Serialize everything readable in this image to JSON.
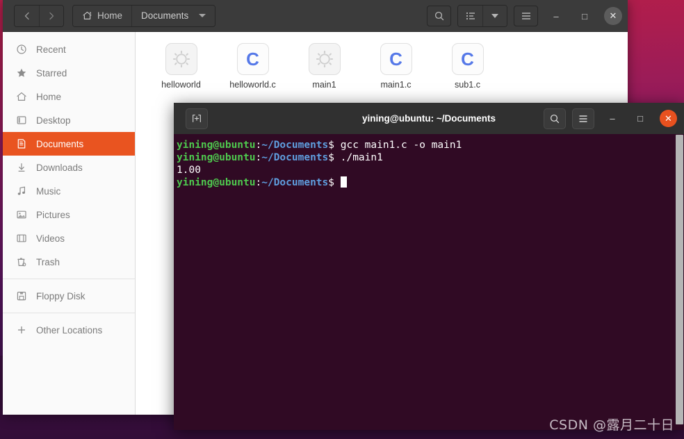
{
  "file_manager": {
    "nav": {
      "back_label": "‹",
      "forward_label": "›"
    },
    "breadcrumbs": [
      {
        "label": "Home",
        "icon": "home-icon"
      },
      {
        "label": "Documents",
        "icon": "chevron-down-icon"
      }
    ],
    "toolbar": {
      "search_icon": "search-icon",
      "list_view_icon": "list-view-icon",
      "view_dropdown_icon": "chevron-down-icon",
      "menu_icon": "hamburger-menu-icon",
      "minimize_label": "–",
      "maximize_label": "□",
      "close_label": "✕"
    },
    "sidebar": {
      "items": [
        {
          "label": "Recent",
          "icon": "clock-icon",
          "active": false
        },
        {
          "label": "Starred",
          "icon": "star-icon",
          "active": false
        },
        {
          "label": "Home",
          "icon": "home-icon",
          "active": false
        },
        {
          "label": "Desktop",
          "icon": "desktop-icon",
          "active": false
        },
        {
          "label": "Documents",
          "icon": "document-icon",
          "active": true
        },
        {
          "label": "Downloads",
          "icon": "download-icon",
          "active": false
        },
        {
          "label": "Music",
          "icon": "music-icon",
          "active": false
        },
        {
          "label": "Pictures",
          "icon": "picture-icon",
          "active": false
        },
        {
          "label": "Videos",
          "icon": "video-icon",
          "active": false
        },
        {
          "label": "Trash",
          "icon": "trash-icon",
          "active": false
        }
      ],
      "devices": [
        {
          "label": "Floppy Disk",
          "icon": "floppy-disk-icon"
        }
      ],
      "other": [
        {
          "label": "Other Locations",
          "icon": "plus-icon"
        }
      ]
    },
    "files": [
      {
        "name": "helloworld",
        "type": "executable",
        "icon": "gear-icon",
        "glyph": ""
      },
      {
        "name": "helloworld.c",
        "type": "c-source",
        "icon": "c-file-icon",
        "glyph": "C"
      },
      {
        "name": "main1",
        "type": "executable",
        "icon": "gear-icon",
        "glyph": ""
      },
      {
        "name": "main1.c",
        "type": "c-source",
        "icon": "c-file-icon",
        "glyph": "C"
      },
      {
        "name": "sub1.c",
        "type": "c-source",
        "icon": "c-file-icon",
        "glyph": "C"
      }
    ]
  },
  "terminal": {
    "title": "yining@ubuntu: ~/Documents",
    "new_tab_icon": "new-tab-icon",
    "search_icon": "search-icon",
    "menu_icon": "hamburger-menu-icon",
    "minimize_label": "–",
    "maximize_label": "□",
    "close_label": "✕",
    "prompt": {
      "user_host": "yining@ubuntu",
      "colon": ":",
      "path": "~/Documents",
      "dollar": "$"
    },
    "lines": [
      {
        "kind": "prompt",
        "command": " gcc main1.c -o main1"
      },
      {
        "kind": "prompt",
        "command": " ./main1"
      },
      {
        "kind": "output",
        "text": "1.00"
      },
      {
        "kind": "prompt-cursor",
        "command": " "
      }
    ]
  },
  "watermark": {
    "text": "CSDN @露月二十日"
  },
  "colors": {
    "ubuntu_orange": "#e95420",
    "terminal_bg": "#300a24",
    "headerbar_bg": "#3b3b3b",
    "terminal_header_bg": "#303030",
    "prompt_user": "#4ec94e",
    "prompt_path": "#5f9fe0",
    "c_icon_blue": "#5679e8"
  }
}
